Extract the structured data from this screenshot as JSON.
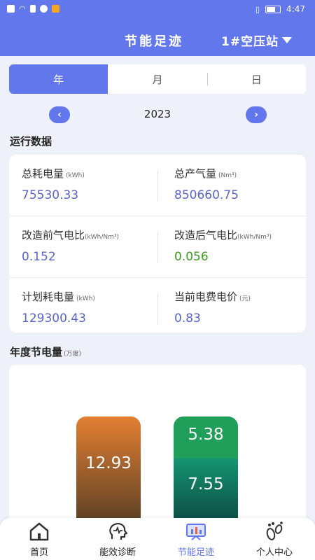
{
  "status_bar": {
    "time": "4:47"
  },
  "header": {
    "title": "节能足迹",
    "station": "1#空压站"
  },
  "tabs": [
    {
      "label": "年",
      "active": true
    },
    {
      "label": "月",
      "active": false
    },
    {
      "label": "日",
      "active": false
    }
  ],
  "year_nav": {
    "year": "2023"
  },
  "running_data": {
    "title": "运行数据",
    "metrics": [
      {
        "label": "总耗电量",
        "unit": "(kWh)",
        "value": "75530.33"
      },
      {
        "label": "总产气量",
        "unit": "(Nm³)",
        "value": "850660.75"
      },
      {
        "label": "改造前气电比",
        "unit": "(kWh/Nm³)",
        "value": "0.152"
      },
      {
        "label": "改造后气电比",
        "unit": "(kWh/Nm³)",
        "value": "0.056"
      },
      {
        "label": "计划耗电量",
        "unit": "(kWh)",
        "value": "129300.43"
      },
      {
        "label": "当前电费电价",
        "unit": "(元)",
        "value": "0.83"
      }
    ]
  },
  "annual_saving": {
    "title": "年度节电量",
    "unit": "(万度)",
    "bar1_value": "12.93",
    "bar2_top_value": "5.38",
    "bar2_bottom_value": "7.55"
  },
  "chart_data": {
    "type": "bar",
    "title": "年度节电量",
    "unit": "万度",
    "bars": [
      {
        "segments": [
          12.93
        ],
        "colors": [
          "#e27f33"
        ]
      },
      {
        "segments": [
          7.55,
          5.38
        ],
        "colors": [
          "#159471",
          "#1f9f5a"
        ]
      }
    ]
  },
  "bottom_nav": [
    {
      "label": "首页",
      "icon": "home-icon"
    },
    {
      "label": "能效诊断",
      "icon": "diagnosis-icon"
    },
    {
      "label": "节能足迹",
      "icon": "footprint-chart-icon",
      "active": true
    },
    {
      "label": "个人中心",
      "icon": "footprint-person-icon"
    }
  ],
  "colors": {
    "primary": "#6377ec",
    "value_blue": "#5a63c8",
    "value_green": "#3f9a22"
  }
}
